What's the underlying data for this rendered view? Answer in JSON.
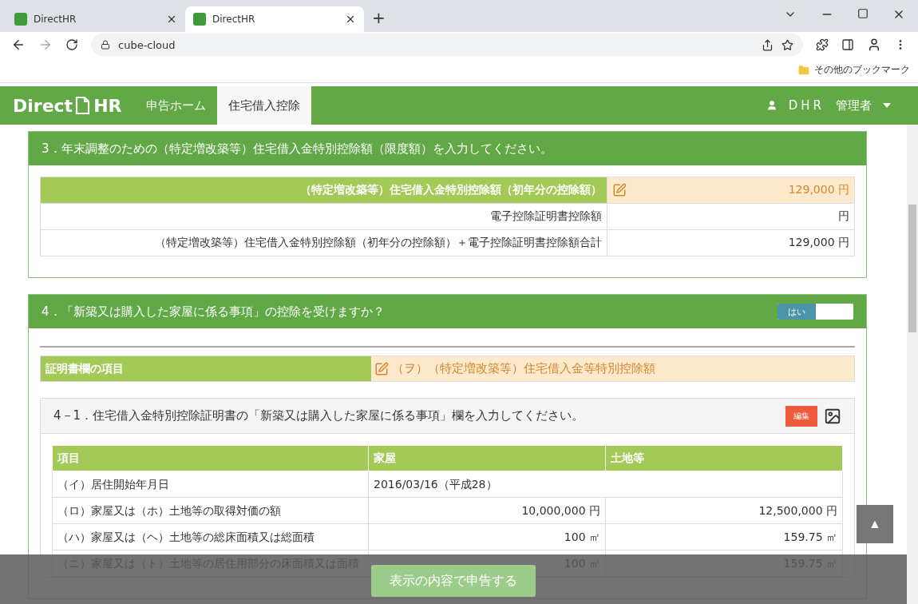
{
  "browser": {
    "tabs": [
      {
        "title": "DirectHR",
        "selected": false
      },
      {
        "title": "DirectHR",
        "selected": true
      }
    ],
    "new_tab": "+",
    "address": "cube-cloud",
    "bookmark": "その他のブックマーク"
  },
  "nav": {
    "logo_left": "Direct",
    "logo_right": "HR",
    "items": [
      {
        "label": "申告ホーム",
        "selected": false
      },
      {
        "label": "住宅借入控除",
        "selected": true
      }
    ],
    "user": "DHR",
    "role": "管理者"
  },
  "section3": {
    "title": "3．年末調整のための（特定増改築等）住宅借入金特別控除額（限度額）を入力してください。",
    "rows": [
      {
        "kind": "highlight",
        "label": "（特定増改築等）住宅借入金特別控除額（初年分の控除額）",
        "value": "129,000 円"
      },
      {
        "kind": "plain",
        "label": "電子控除証明書控除額",
        "value": "円"
      },
      {
        "kind": "plain",
        "label": "（特定増改築等）住宅借入金特別控除額（初年分の控除額）＋電子控除証明書控除額合計",
        "value": "129,000 円"
      }
    ]
  },
  "section4": {
    "title": "4．「新築又は購入した家屋に係る事項」の控除を受けますか？",
    "toggle": {
      "label": "はい",
      "on": true
    },
    "cert": {
      "label": "証明書欄の項目",
      "value": "（ヲ）（特定増改築等）住宅借入金等特別控除額"
    },
    "sub": {
      "title": "4－1．住宅借入金特別控除証明書の「新築又は購入した家屋に係る事項」欄を入力してください。",
      "edit_button": "編集",
      "columns": [
        "項目",
        "家屋",
        "土地等"
      ],
      "rows": [
        {
          "kind": "span",
          "cells": [
            "（イ）居住開始年月日",
            "2016/03/16（平成28）"
          ]
        },
        {
          "kind": "amount",
          "cells": [
            "（ロ）家屋又は（ホ）土地等の取得対価の額",
            "10,000,000 円",
            "12,500,000 円"
          ]
        },
        {
          "kind": "amount",
          "cells": [
            "（ハ）家屋又は（ヘ）土地等の総床面積又は総面積",
            "100 ㎡",
            "159.75 ㎡"
          ]
        },
        {
          "kind": "amount",
          "cells": [
            "（ニ）家屋又は（ト）土地等の居住用部分の床面積又は面積",
            "100 ㎡",
            "159.75 ㎡"
          ]
        }
      ]
    }
  },
  "submit_button": "表示の内容で申告する",
  "scroll_top": "▲"
}
